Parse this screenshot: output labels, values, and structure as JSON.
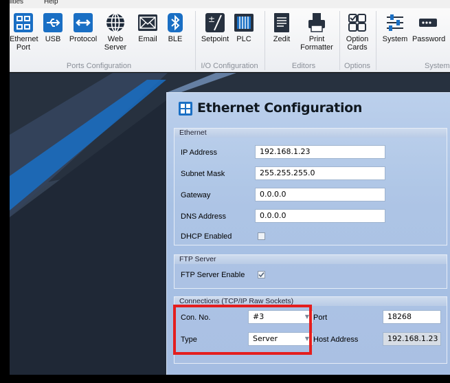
{
  "menu": {
    "item1": "lities",
    "item2": "Help"
  },
  "ribbon": {
    "groups": {
      "ports": "Ports Configuration",
      "io": "I/O Configuration",
      "editors": "Editors",
      "options": "Options",
      "system": "System"
    },
    "buttons": {
      "ethernet_line1": "Ethernet",
      "ethernet_line2": "Port",
      "usb": "USB",
      "protocol": "Protocol",
      "web_line1": "Web",
      "web_line2": "Server",
      "email": "Email",
      "ble": "BLE",
      "setpoint": "Setpoint",
      "plc": "PLC",
      "zedit": "Zedit",
      "print_line1": "Print",
      "print_line2": "Formatter",
      "option_line1": "Option",
      "option_line2": "Cards",
      "system": "System",
      "password": "Password"
    }
  },
  "dialog": {
    "title": "Ethernet Configuration",
    "ethernet": {
      "header": "Ethernet",
      "ip_label": "IP Address",
      "ip_value": "192.168.1.23",
      "subnet_label": "Subnet Mask",
      "subnet_value": "255.255.255.0",
      "gateway_label": "Gateway",
      "gateway_value": "0.0.0.0",
      "dns_label": "DNS Address",
      "dns_value": "0.0.0.0",
      "dhcp_label": "DHCP Enabled",
      "dhcp_checked": false
    },
    "ftp": {
      "header": "FTP Server",
      "enable_label": "FTP Server Enable",
      "enable_checked": true
    },
    "connections": {
      "header": "Connections (TCP/IP Raw Sockets)",
      "con_label": "Con. No.",
      "con_value": "#3",
      "port_label": "Port",
      "port_value": "18268",
      "type_label": "Type",
      "type_value": "Server",
      "host_label": "Host Address",
      "host_value": "192.168.1.23"
    }
  },
  "colors": {
    "highlight": "#e41e1e",
    "panel": "#a8c1e4",
    "accent": "#1a6fc4"
  }
}
